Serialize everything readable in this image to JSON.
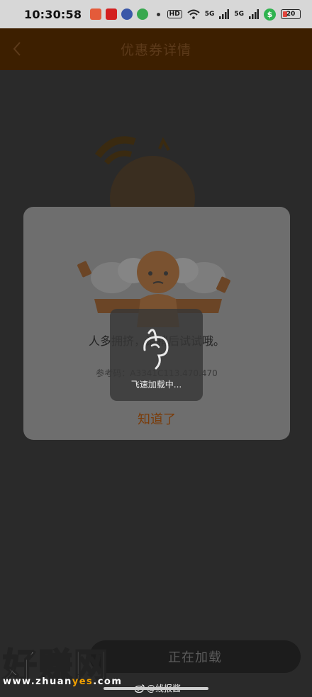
{
  "status_bar": {
    "time": "10:30:58",
    "hd": "HD",
    "sig1": "5G",
    "sig2": "5G",
    "battery": "20"
  },
  "header": {
    "title": "优惠券详情"
  },
  "modal": {
    "message": "人多拥挤，请稍后试试哦。",
    "reference": "参考码：A3341C113.470.470",
    "confirm": "知道了"
  },
  "toast": {
    "text": "飞速加载中..."
  },
  "bottom_button": {
    "label": "正在加载"
  },
  "watermark": {
    "logo": "好赚网",
    "url_prefix": "www.zhuan",
    "url_highlight": "yes",
    "url_suffix": ".com",
    "weibo": "@线报酱"
  },
  "colors": {
    "header_bg": "#3d1f00",
    "accent": "#7a3c0a",
    "modal_bg": "#6e6e6e"
  },
  "icons": {
    "back": "chevron-left-icon",
    "spinner": "loading-spinner-icon"
  }
}
